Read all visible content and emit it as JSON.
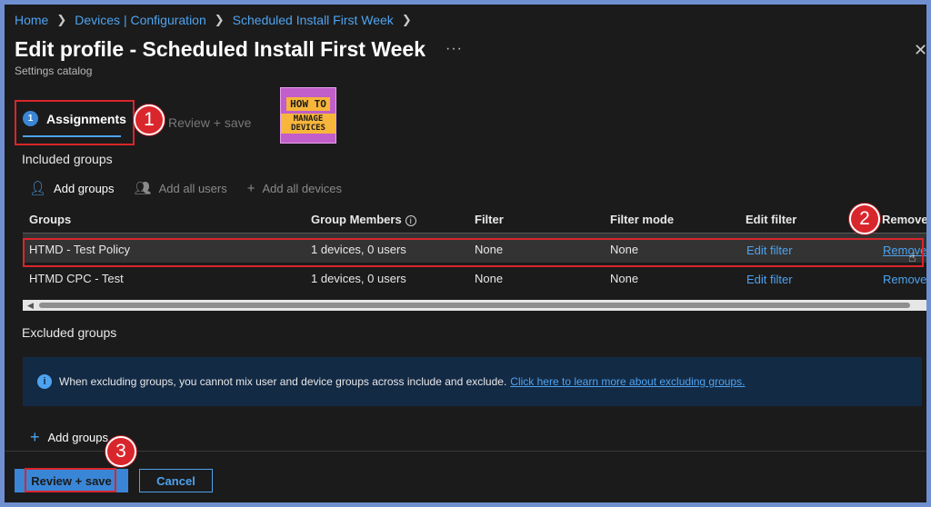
{
  "breadcrumb": [
    "Home",
    "Devices | Configuration",
    "Scheduled Install First Week"
  ],
  "page": {
    "title": "Edit profile - Scheduled Install First Week",
    "subtitle": "Settings catalog",
    "more_icon": "ellipsis-icon",
    "close_icon": "close-icon"
  },
  "tabs": {
    "active": {
      "step": "1",
      "label": "Assignments"
    },
    "next": {
      "label": "Review + save"
    }
  },
  "logo": {
    "line1": "HOW TO",
    "line2": "MANAGE DEVICES"
  },
  "callouts": [
    "1",
    "2",
    "3"
  ],
  "included": {
    "title": "Included groups",
    "toolbar": {
      "add_groups": "Add groups",
      "add_all_users": "Add all users",
      "add_all_devices": "Add all devices"
    },
    "columns": [
      "Groups",
      "Group Members",
      "Filter",
      "Filter mode",
      "Edit filter",
      "Remove"
    ],
    "rows": [
      {
        "group": "HTMD - Test Policy",
        "members": "1 devices, 0 users",
        "filter": "None",
        "filter_mode": "None",
        "edit_filter": "Edit filter",
        "remove": "Remove"
      },
      {
        "group": "HTMD CPC - Test",
        "members": "1 devices, 0 users",
        "filter": "None",
        "filter_mode": "None",
        "edit_filter": "Edit filter",
        "remove": "Remove"
      }
    ]
  },
  "excluded": {
    "title": "Excluded groups",
    "info_text": "When excluding groups, you cannot mix user and device groups across include and exclude.",
    "info_link": "Click here to learn more about excluding groups.",
    "add_groups": "Add groups"
  },
  "footer": {
    "review_save": "Review + save",
    "cancel": "Cancel"
  },
  "colors": {
    "accent": "#4ea3f0",
    "highlight": "#d9262c",
    "background": "#1b1b1b"
  }
}
